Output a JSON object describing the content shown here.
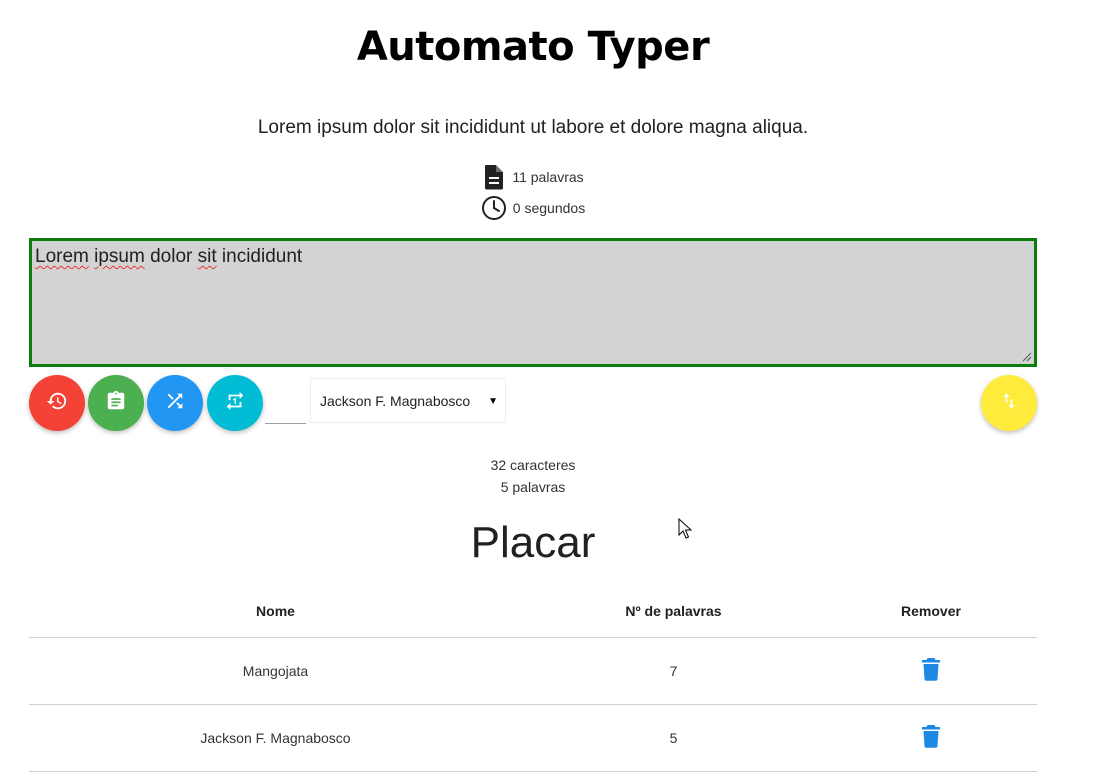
{
  "header": {
    "title": "Automato Typer"
  },
  "phrase": {
    "text": "Lorem ipsum dolor sit incididunt ut labore et dolore magna aliqua."
  },
  "phrase_info": {
    "word_count": "11 palavras",
    "time": "0 segundos",
    "word_icon": "document-icon",
    "time_icon": "clock-icon"
  },
  "typing": {
    "value": "Lorem ipsum dolor sit incididunt",
    "typed_words": [
      "Lorem",
      "ipsum",
      "dolor",
      "sit",
      "incididunt"
    ],
    "border_color": "#0a7d0a",
    "background_color": "#d3d3d3"
  },
  "controls": {
    "buttons": [
      {
        "name": "restart",
        "icon": "restore-icon",
        "color": "#f44336"
      },
      {
        "name": "copy",
        "icon": "clipboard-icon",
        "color": "#4caf50"
      },
      {
        "name": "shuffle",
        "icon": "shuffle-icon",
        "color": "#2196f3"
      },
      {
        "name": "repeat",
        "icon": "repeat-one-icon",
        "color": "#00bcd4"
      },
      {
        "name": "sort",
        "icon": "sort-arrows-icon",
        "color": "#ffeb3b"
      }
    ],
    "time_input_value": "",
    "user_select": {
      "selected": "Jackson F. Magnabosco"
    }
  },
  "stats": {
    "characters": "32 caracteres",
    "words": "5 palavras"
  },
  "scoreboard": {
    "title": "Placar",
    "headers": [
      "Nome",
      "Nº de palavras",
      "Remover"
    ],
    "rows": [
      {
        "name": "Mangojata",
        "words": "7"
      },
      {
        "name": "Jackson F. Magnabosco",
        "words": "5"
      }
    ],
    "remove_icon": "trash-icon",
    "remove_color": "#1e88e5"
  }
}
